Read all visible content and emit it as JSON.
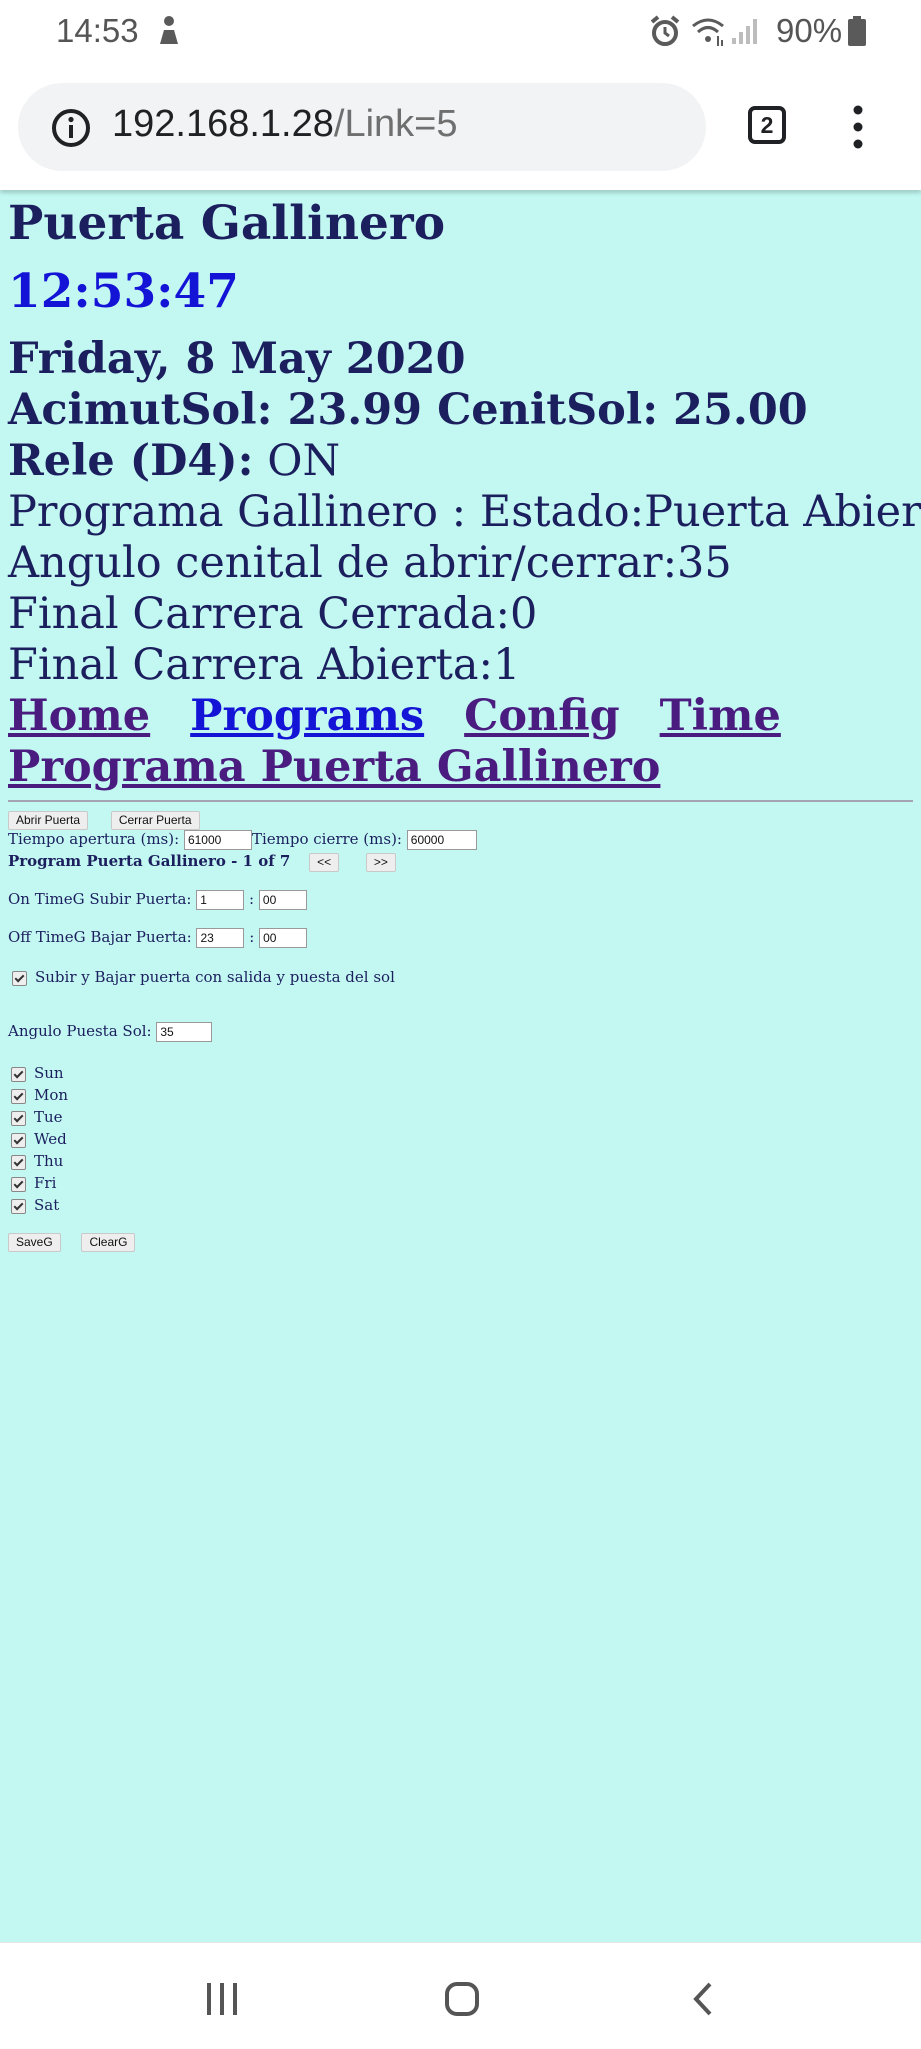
{
  "status_bar": {
    "time": "14:53",
    "battery": "90%",
    "icons": [
      "person-icon",
      "alarm-icon",
      "wifi-icon",
      "signal-icon",
      "battery-icon"
    ]
  },
  "browser": {
    "url_host": "192.168.1.28",
    "url_path": "/Link=5",
    "tab_count": "2"
  },
  "page": {
    "title": "Puerta Gallinero",
    "clock": "12:53:47",
    "date": "Friday, 8 May 2020",
    "azimuth_label": "AcimutSol:",
    "azimuth_value": "23.99",
    "zenith_label": "CenitSol:",
    "zenith_value": "25.00",
    "relay_label": "Rele (D4):",
    "relay_state": "ON",
    "program_status": "Programa Gallinero : Estado:Puerta Abierta",
    "zenith_angle": "Angulo cenital de abrir/cerrar:35",
    "limit_closed": "Final Carrera Cerrada:0",
    "limit_open": "Final Carrera Abierta:1",
    "nav": {
      "home": "Home",
      "programs": "Programs",
      "config": "Config",
      "time": "Time",
      "program_door": "Programa Puerta Gallinero"
    }
  },
  "form": {
    "open_button": "Abrir Puerta",
    "close_button": "Cerrar Puerta",
    "open_time_label": "Tiempo apertura (ms):",
    "open_time_value": "61000",
    "close_time_label": "Tiempo cierre (ms):",
    "close_time_value": "60000",
    "program_label": "Program Puerta Gallinero - 1 of 7",
    "prev_button": "<<",
    "next_button": ">>",
    "on_time_label": "On TimeG Subir Puerta:",
    "on_hour": "1",
    "on_minute": "00",
    "off_time_label": "Off TimeG Bajar Puerta:",
    "off_hour": "23",
    "off_minute": "00",
    "time_sep": ":",
    "sun_option_label": "Subir y Bajar puerta con salida y puesta del sol",
    "sunset_angle_label": "Angulo Puesta Sol:",
    "sunset_angle_value": "35",
    "days": [
      "Sun",
      "Mon",
      "Tue",
      "Wed",
      "Thu",
      "Fri",
      "Sat"
    ],
    "save_button": "SaveG",
    "clear_button": "ClearG"
  },
  "system_nav": {
    "icons": [
      "recents-icon",
      "home-icon",
      "back-icon"
    ]
  }
}
